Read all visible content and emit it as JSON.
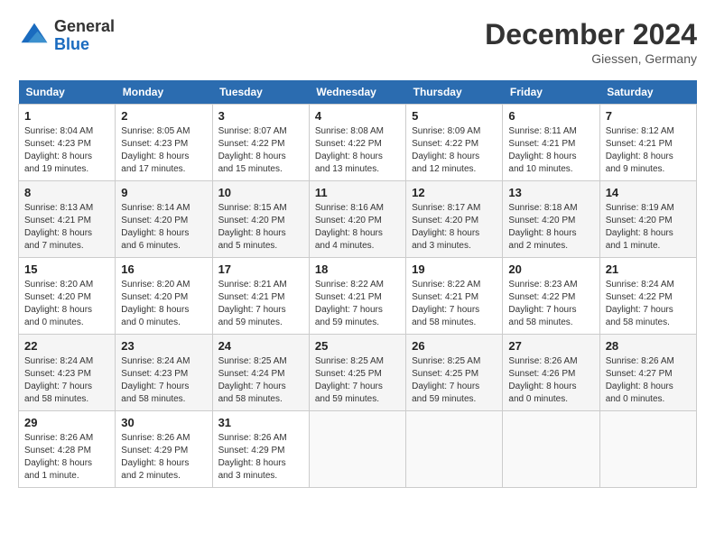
{
  "logo": {
    "general": "General",
    "blue": "Blue"
  },
  "title": "December 2024",
  "location": "Giessen, Germany",
  "days_of_week": [
    "Sunday",
    "Monday",
    "Tuesday",
    "Wednesday",
    "Thursday",
    "Friday",
    "Saturday"
  ],
  "weeks": [
    [
      {
        "day": "1",
        "sunrise": "Sunrise: 8:04 AM",
        "sunset": "Sunset: 4:23 PM",
        "daylight": "Daylight: 8 hours and 19 minutes."
      },
      {
        "day": "2",
        "sunrise": "Sunrise: 8:05 AM",
        "sunset": "Sunset: 4:23 PM",
        "daylight": "Daylight: 8 hours and 17 minutes."
      },
      {
        "day": "3",
        "sunrise": "Sunrise: 8:07 AM",
        "sunset": "Sunset: 4:22 PM",
        "daylight": "Daylight: 8 hours and 15 minutes."
      },
      {
        "day": "4",
        "sunrise": "Sunrise: 8:08 AM",
        "sunset": "Sunset: 4:22 PM",
        "daylight": "Daylight: 8 hours and 13 minutes."
      },
      {
        "day": "5",
        "sunrise": "Sunrise: 8:09 AM",
        "sunset": "Sunset: 4:22 PM",
        "daylight": "Daylight: 8 hours and 12 minutes."
      },
      {
        "day": "6",
        "sunrise": "Sunrise: 8:11 AM",
        "sunset": "Sunset: 4:21 PM",
        "daylight": "Daylight: 8 hours and 10 minutes."
      },
      {
        "day": "7",
        "sunrise": "Sunrise: 8:12 AM",
        "sunset": "Sunset: 4:21 PM",
        "daylight": "Daylight: 8 hours and 9 minutes."
      }
    ],
    [
      {
        "day": "8",
        "sunrise": "Sunrise: 8:13 AM",
        "sunset": "Sunset: 4:21 PM",
        "daylight": "Daylight: 8 hours and 7 minutes."
      },
      {
        "day": "9",
        "sunrise": "Sunrise: 8:14 AM",
        "sunset": "Sunset: 4:20 PM",
        "daylight": "Daylight: 8 hours and 6 minutes."
      },
      {
        "day": "10",
        "sunrise": "Sunrise: 8:15 AM",
        "sunset": "Sunset: 4:20 PM",
        "daylight": "Daylight: 8 hours and 5 minutes."
      },
      {
        "day": "11",
        "sunrise": "Sunrise: 8:16 AM",
        "sunset": "Sunset: 4:20 PM",
        "daylight": "Daylight: 8 hours and 4 minutes."
      },
      {
        "day": "12",
        "sunrise": "Sunrise: 8:17 AM",
        "sunset": "Sunset: 4:20 PM",
        "daylight": "Daylight: 8 hours and 3 minutes."
      },
      {
        "day": "13",
        "sunrise": "Sunrise: 8:18 AM",
        "sunset": "Sunset: 4:20 PM",
        "daylight": "Daylight: 8 hours and 2 minutes."
      },
      {
        "day": "14",
        "sunrise": "Sunrise: 8:19 AM",
        "sunset": "Sunset: 4:20 PM",
        "daylight": "Daylight: 8 hours and 1 minute."
      }
    ],
    [
      {
        "day": "15",
        "sunrise": "Sunrise: 8:20 AM",
        "sunset": "Sunset: 4:20 PM",
        "daylight": "Daylight: 8 hours and 0 minutes."
      },
      {
        "day": "16",
        "sunrise": "Sunrise: 8:20 AM",
        "sunset": "Sunset: 4:20 PM",
        "daylight": "Daylight: 8 hours and 0 minutes."
      },
      {
        "day": "17",
        "sunrise": "Sunrise: 8:21 AM",
        "sunset": "Sunset: 4:21 PM",
        "daylight": "Daylight: 7 hours and 59 minutes."
      },
      {
        "day": "18",
        "sunrise": "Sunrise: 8:22 AM",
        "sunset": "Sunset: 4:21 PM",
        "daylight": "Daylight: 7 hours and 59 minutes."
      },
      {
        "day": "19",
        "sunrise": "Sunrise: 8:22 AM",
        "sunset": "Sunset: 4:21 PM",
        "daylight": "Daylight: 7 hours and 58 minutes."
      },
      {
        "day": "20",
        "sunrise": "Sunrise: 8:23 AM",
        "sunset": "Sunset: 4:22 PM",
        "daylight": "Daylight: 7 hours and 58 minutes."
      },
      {
        "day": "21",
        "sunrise": "Sunrise: 8:24 AM",
        "sunset": "Sunset: 4:22 PM",
        "daylight": "Daylight: 7 hours and 58 minutes."
      }
    ],
    [
      {
        "day": "22",
        "sunrise": "Sunrise: 8:24 AM",
        "sunset": "Sunset: 4:23 PM",
        "daylight": "Daylight: 7 hours and 58 minutes."
      },
      {
        "day": "23",
        "sunrise": "Sunrise: 8:24 AM",
        "sunset": "Sunset: 4:23 PM",
        "daylight": "Daylight: 7 hours and 58 minutes."
      },
      {
        "day": "24",
        "sunrise": "Sunrise: 8:25 AM",
        "sunset": "Sunset: 4:24 PM",
        "daylight": "Daylight: 7 hours and 58 minutes."
      },
      {
        "day": "25",
        "sunrise": "Sunrise: 8:25 AM",
        "sunset": "Sunset: 4:25 PM",
        "daylight": "Daylight: 7 hours and 59 minutes."
      },
      {
        "day": "26",
        "sunrise": "Sunrise: 8:25 AM",
        "sunset": "Sunset: 4:25 PM",
        "daylight": "Daylight: 7 hours and 59 minutes."
      },
      {
        "day": "27",
        "sunrise": "Sunrise: 8:26 AM",
        "sunset": "Sunset: 4:26 PM",
        "daylight": "Daylight: 8 hours and 0 minutes."
      },
      {
        "day": "28",
        "sunrise": "Sunrise: 8:26 AM",
        "sunset": "Sunset: 4:27 PM",
        "daylight": "Daylight: 8 hours and 0 minutes."
      }
    ],
    [
      {
        "day": "29",
        "sunrise": "Sunrise: 8:26 AM",
        "sunset": "Sunset: 4:28 PM",
        "daylight": "Daylight: 8 hours and 1 minute."
      },
      {
        "day": "30",
        "sunrise": "Sunrise: 8:26 AM",
        "sunset": "Sunset: 4:29 PM",
        "daylight": "Daylight: 8 hours and 2 minutes."
      },
      {
        "day": "31",
        "sunrise": "Sunrise: 8:26 AM",
        "sunset": "Sunset: 4:29 PM",
        "daylight": "Daylight: 8 hours and 3 minutes."
      },
      null,
      null,
      null,
      null
    ]
  ]
}
